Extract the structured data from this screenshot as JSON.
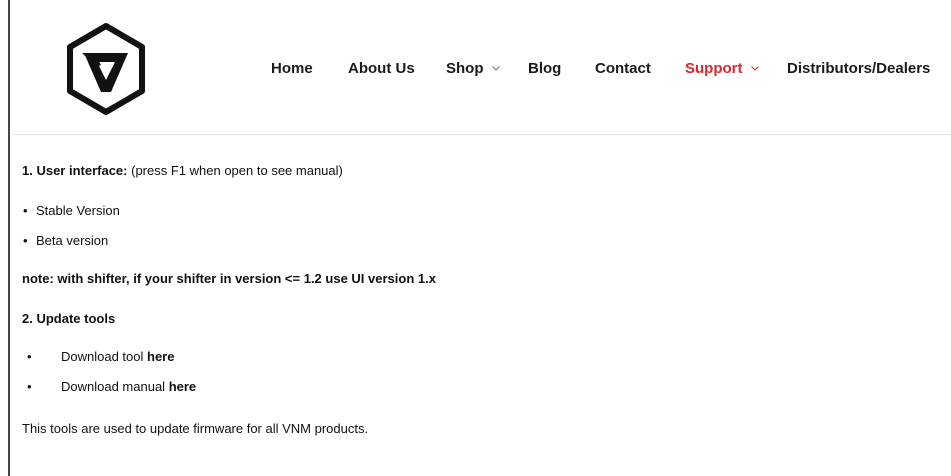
{
  "brand": {
    "logo_icon": "vnm-hexagon-v-logo-icon"
  },
  "nav": {
    "items": [
      {
        "label": "Home",
        "has_dropdown": false,
        "active": false
      },
      {
        "label": "About Us",
        "has_dropdown": false,
        "active": false
      },
      {
        "label": "Shop",
        "has_dropdown": true,
        "active": false
      },
      {
        "label": "Blog",
        "has_dropdown": false,
        "active": false
      },
      {
        "label": "Contact",
        "has_dropdown": false,
        "active": false
      },
      {
        "label": "Support",
        "has_dropdown": true,
        "active": true
      },
      {
        "label": "Distributors/Dealers",
        "has_dropdown": false,
        "active": false
      }
    ],
    "active_color": "#e3242b"
  },
  "content": {
    "section1": {
      "title": "1. User interface:",
      "hint": "(press F1 when open to see manual)",
      "items": [
        "Stable Version",
        "Beta version"
      ]
    },
    "note": "note: with shifter, if your shifter in version <= 1.2 use UI version  1.x",
    "section2": {
      "title": "2.  Update tools",
      "items": [
        {
          "text": "Download tool ",
          "link": "here"
        },
        {
          "text": "Download manual ",
          "link": "here"
        }
      ]
    },
    "footer_text": "This tools are used to update firmware for all VNM products."
  }
}
